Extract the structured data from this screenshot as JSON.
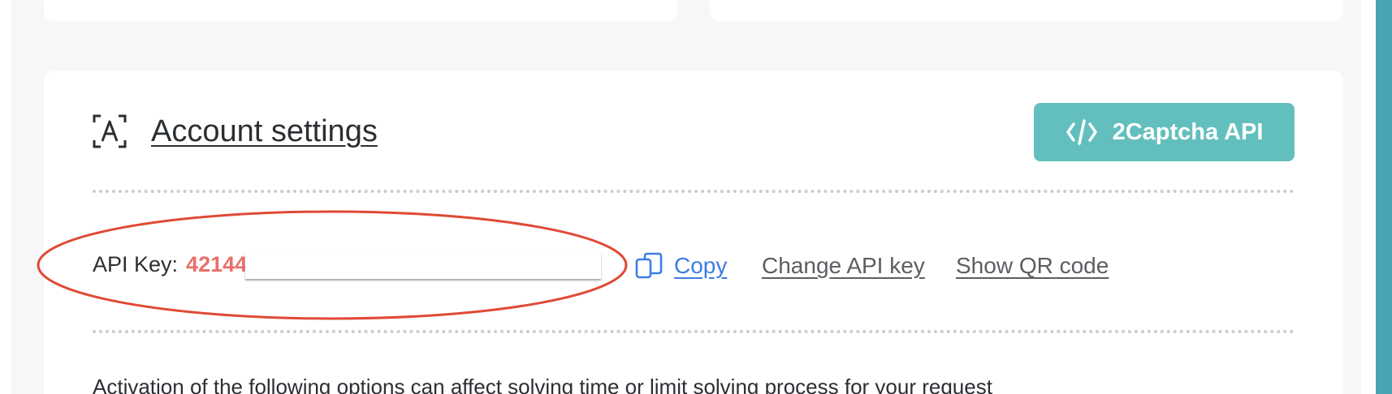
{
  "section": {
    "title": "Account settings",
    "icon": "account-scan-icon"
  },
  "api_button": {
    "label": "2Captcha API",
    "icon": "code-icon",
    "color": "#63bfbd"
  },
  "api_key": {
    "label": "API Key:",
    "value_visible": "42144",
    "value_color": "#e8706a"
  },
  "actions": {
    "copy_label": "Copy",
    "copy_icon": "copy-icon",
    "change_label": "Change API key",
    "qr_label": "Show QR code"
  },
  "notice": {
    "text": "Activation of the following options can affect solving time or limit solving process for your request"
  },
  "colors": {
    "accent_teal": "#63bfbd",
    "highlight_red": "#e04a35",
    "link_blue": "#3d7ee0",
    "scrollbar_teal": "#4aa3b3"
  }
}
